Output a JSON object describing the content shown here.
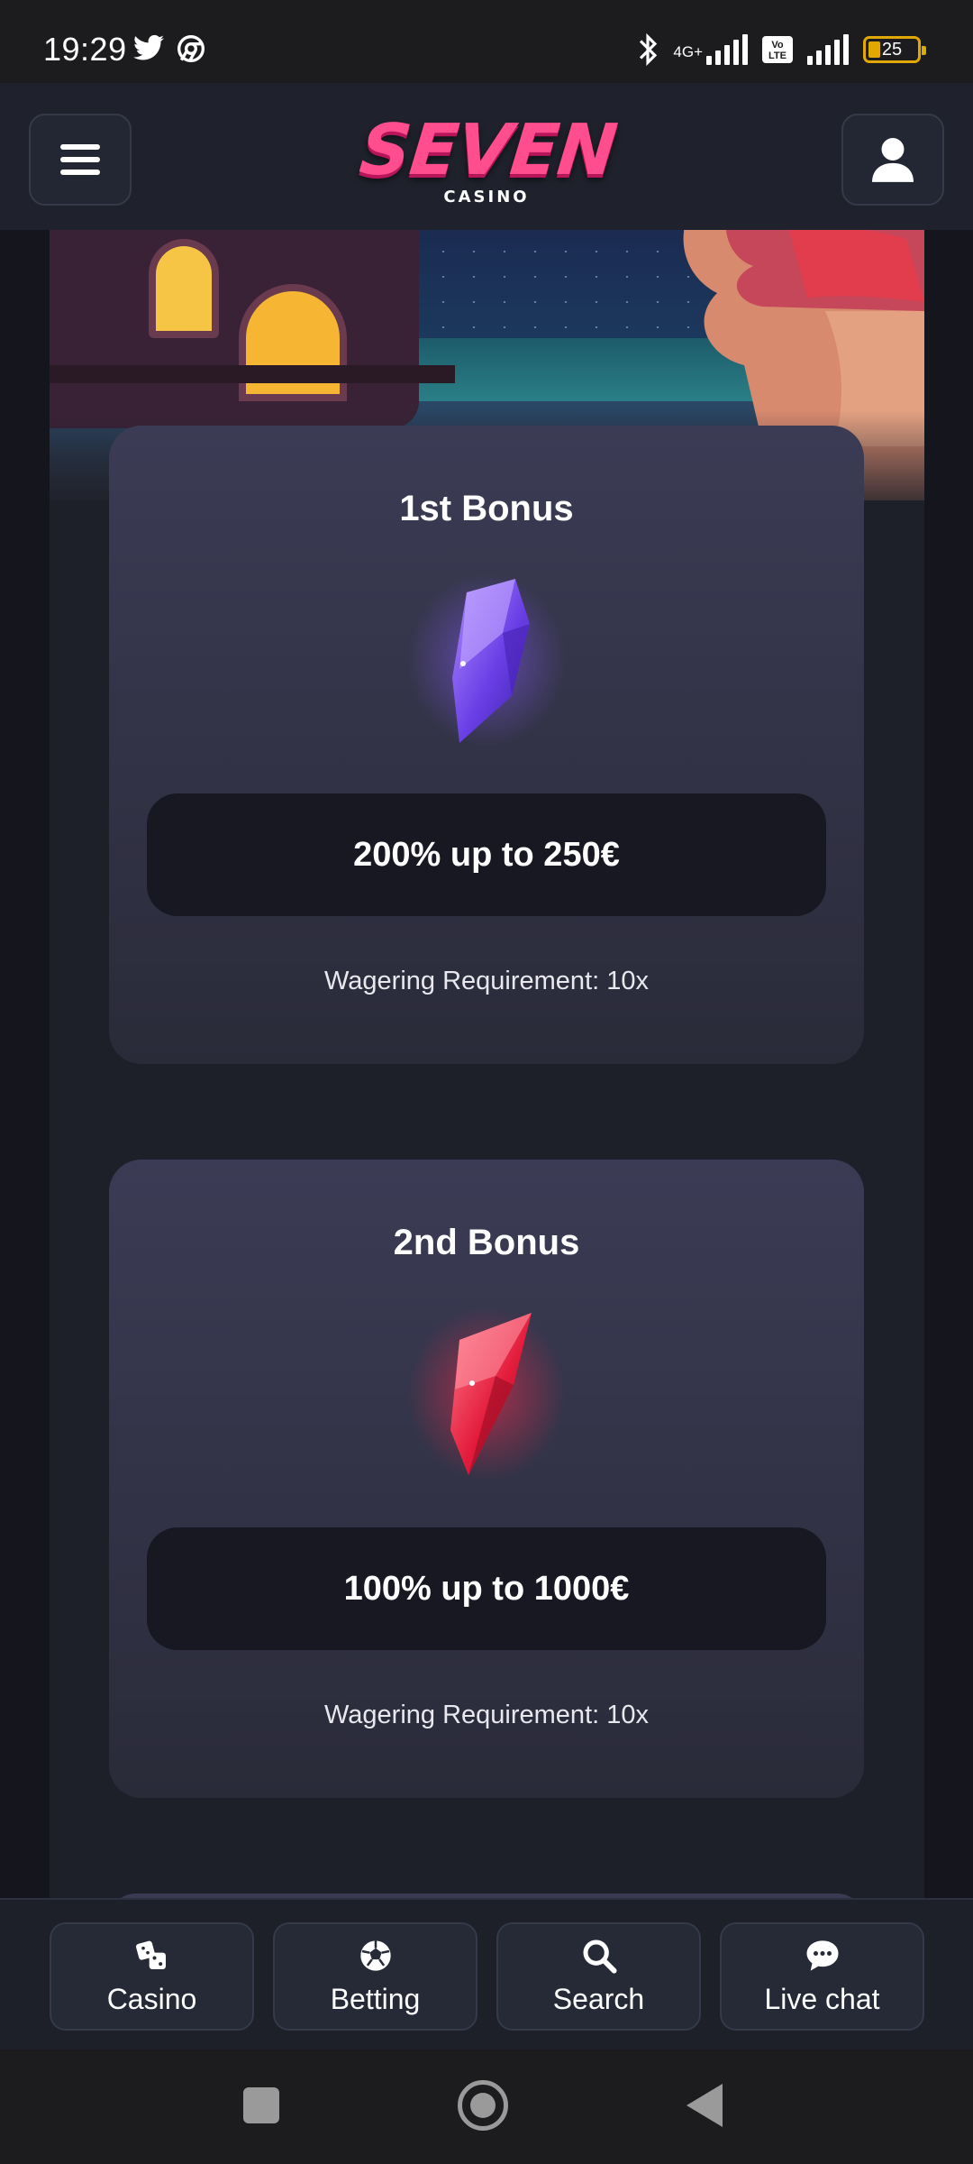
{
  "status_bar": {
    "time": "19:29",
    "network": "4G+",
    "volte": "Vo LTE",
    "battery": "25",
    "battery_level": 0.25,
    "icons": [
      "twitter-icon",
      "chrome-icon",
      "bluetooth-icon",
      "signal-icon",
      "signal-icon",
      "battery-icon"
    ]
  },
  "header": {
    "logo_text": "SEVEN",
    "logo_sub": "CASINO",
    "logo_color": "#ff4d8d",
    "menu_icon": "hamburger-icon",
    "account_icon": "user-icon"
  },
  "bonuses": [
    {
      "title": "1st Bonus",
      "gem": "purple-gem",
      "gem_color": "#7b4cf0",
      "offer": "200% up to 250€",
      "wagering": "Wagering Requirement: 10x"
    },
    {
      "title": "2nd Bonus",
      "gem": "red-gem",
      "gem_color": "#f0284a",
      "offer": "100% up to 1000€",
      "wagering": "Wagering Requirement: 10x"
    }
  ],
  "bottom_nav": [
    {
      "label": "Casino",
      "icon": "dice-icon"
    },
    {
      "label": "Betting",
      "icon": "soccer-ball-icon"
    },
    {
      "label": "Search",
      "icon": "search-icon"
    },
    {
      "label": "Live chat",
      "icon": "chat-bubble-icon"
    }
  ],
  "android_nav": [
    "recent-apps-icon",
    "home-icon",
    "back-icon"
  ]
}
